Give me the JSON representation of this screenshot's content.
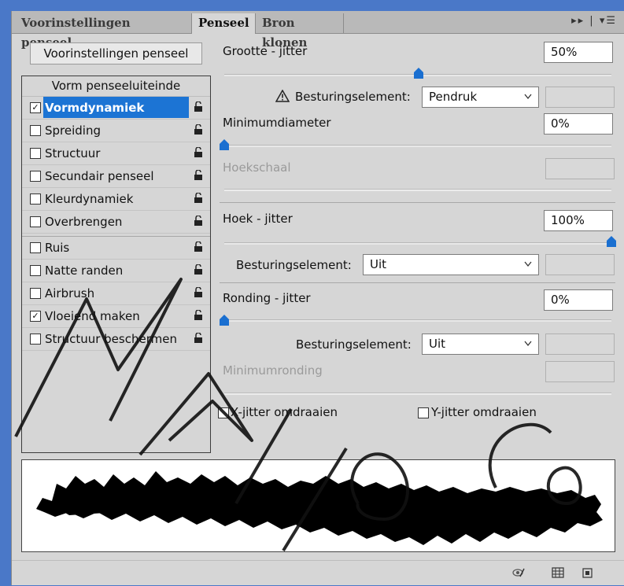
{
  "tabs": [
    {
      "label": "Voorinstellingen penseel",
      "active": false
    },
    {
      "label": "Penseel",
      "active": true
    },
    {
      "label": "Bron klonen",
      "active": false
    }
  ],
  "presets_button": "Voorinstellingen penseel",
  "list": {
    "header": "Vorm penseeluiteinde",
    "items": [
      {
        "label": "Vormdynamiek",
        "checked": true,
        "selected": true
      },
      {
        "label": "Spreiding",
        "checked": false
      },
      {
        "label": "Structuur",
        "checked": false
      },
      {
        "label": "Secundair penseel",
        "checked": false
      },
      {
        "label": "Kleurdynamiek",
        "checked": false
      },
      {
        "label": "Overbrengen",
        "checked": false
      },
      {
        "label": "Ruis",
        "checked": false
      },
      {
        "label": "Natte randen",
        "checked": false
      },
      {
        "label": "Airbrush",
        "checked": false
      },
      {
        "label": "Vloeiend maken",
        "checked": true
      },
      {
        "label": "Structuur beschermen",
        "checked": false
      }
    ]
  },
  "settings": {
    "size_jitter": {
      "label": "Grootte - jitter",
      "value": "50%",
      "slider": 0.5
    },
    "control1": {
      "label": "Besturingselement:",
      "value": "Pendruk"
    },
    "min_diameter": {
      "label": "Minimumdiameter",
      "value": "0%",
      "slider": 0.0
    },
    "tilt_scale": {
      "label": "Hoekschaal"
    },
    "angle_jitter": {
      "label": "Hoek - jitter",
      "value": "100%",
      "slider": 1.0
    },
    "control2": {
      "label": "Besturingselement:",
      "value": "Uit"
    },
    "roundness_jitter": {
      "label": "Ronding - jitter",
      "value": "0%",
      "slider": 0.0
    },
    "control3": {
      "label": "Besturingselement:",
      "value": "Uit"
    },
    "min_roundness": {
      "label": "Minimumronding"
    },
    "flip_x": {
      "label": "X-jitter omdraaien",
      "checked": false
    },
    "flip_y": {
      "label": "Y-jitter omdraaien",
      "checked": false
    }
  },
  "colors": {
    "accent": "#1c74d4",
    "panel": "#d6d6d6",
    "thumb": "#1a6fd0"
  }
}
